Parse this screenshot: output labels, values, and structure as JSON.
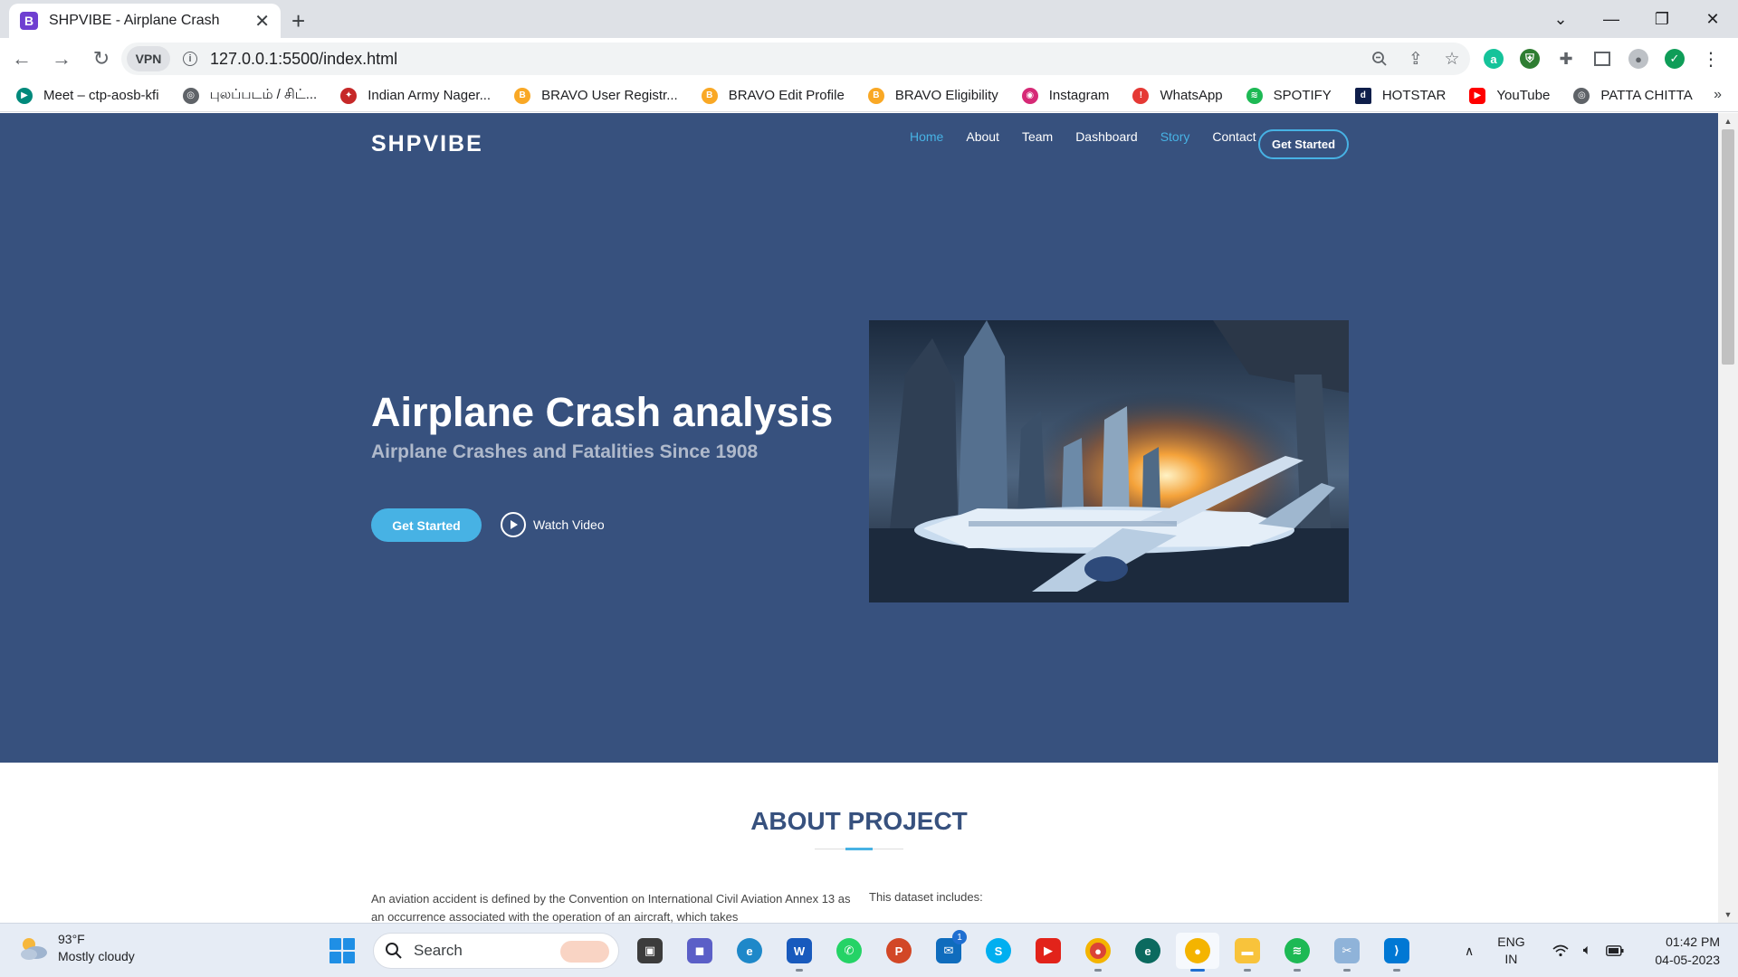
{
  "browser": {
    "tab_title": "SHPVIBE - Airplane Crash",
    "tab_favicon": "B",
    "url": "127.0.0.1:5500/index.html",
    "vpn_label": "VPN",
    "bookmarks": [
      {
        "label": "Meet – ctp-aosb-kfi",
        "icon": "meet-icon",
        "color": "#00897b"
      },
      {
        "label": "புலப்படம் / சிட்...",
        "icon": "globe-icon",
        "color": "#5f6368"
      },
      {
        "label": "Indian Army Nager...",
        "icon": "army-icon",
        "color": "#c62828"
      },
      {
        "label": "BRAVO User Registr...",
        "icon": "bravo-icon",
        "color": "#f9a825"
      },
      {
        "label": "BRAVO Edit Profile",
        "icon": "bravo-icon",
        "color": "#f9a825"
      },
      {
        "label": "BRAVO Eligibility",
        "icon": "bravo-icon",
        "color": "#f9a825"
      },
      {
        "label": "Instagram",
        "icon": "instagram-icon",
        "color": "#d62976"
      },
      {
        "label": "WhatsApp",
        "icon": "whatsapp-icon",
        "color": "#e53935"
      },
      {
        "label": "SPOTIFY",
        "icon": "spotify-icon",
        "color": "#1db954"
      },
      {
        "label": "HOTSTAR",
        "icon": "hotstar-icon",
        "color": "#0f1e4a"
      },
      {
        "label": "YouTube",
        "icon": "youtube-icon",
        "color": "#ff0000"
      },
      {
        "label": "PATTA CHITTA",
        "icon": "globe-icon",
        "color": "#5f6368"
      }
    ]
  },
  "site": {
    "logo": "SHPVIBE",
    "nav": [
      {
        "label": "Home",
        "active": true
      },
      {
        "label": "About",
        "active": false
      },
      {
        "label": "Team",
        "active": false
      },
      {
        "label": "Dashboard",
        "active": false
      },
      {
        "label": "Story",
        "active": true
      },
      {
        "label": "Contact",
        "active": false
      }
    ],
    "nav_cta": "Get Started",
    "hero": {
      "title": "Airplane Crash analysis",
      "subtitle": "Airplane Crashes and Fatalities Since 1908",
      "primary_button": "Get Started",
      "video_button": "Watch Video"
    },
    "about": {
      "title": "ABOUT PROJECT",
      "paragraph_left": "An aviation accident is defined by the Convention on International Civil Aviation Annex 13 as an occurrence associated with the operation of an aircraft, which takes",
      "paragraph_right": "This dataset includes:"
    }
  },
  "taskbar": {
    "weather_temp": "93°F",
    "weather_desc": "Mostly cloudy",
    "search_placeholder": "Search",
    "mail_badge": "1",
    "lang_top": "ENG",
    "lang_bottom": "IN",
    "time": "01:42 PM",
    "date": "04-05-2023"
  },
  "colors": {
    "hero_bg": "#37517e",
    "accent": "#47b2e4"
  }
}
